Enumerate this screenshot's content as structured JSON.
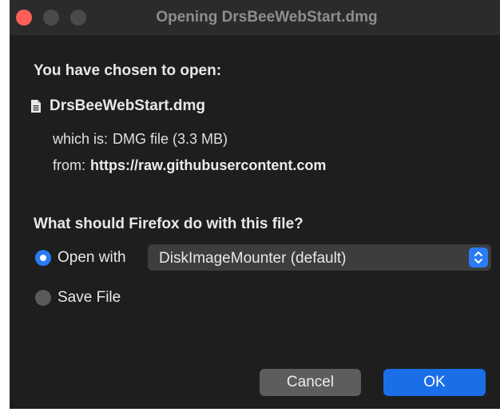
{
  "window": {
    "title": "Opening DrsBeeWebStart.dmg"
  },
  "dialog": {
    "heading": "You have chosen to open:",
    "file_name": "DrsBeeWebStart.dmg",
    "which_label": "which is:",
    "which_value": "DMG file (3.3 MB)",
    "from_label": "from:",
    "from_value": "https://raw.githubusercontent.com",
    "question": "What should Firefox do with this file?",
    "open_with_label": "Open with",
    "open_with_selected": "DiskImageMounter (default)",
    "save_file_label": "Save File",
    "open_with_checked": true,
    "save_file_checked": false
  },
  "buttons": {
    "cancel": "Cancel",
    "ok": "OK"
  },
  "colors": {
    "accent": "#2a7bf6",
    "close": "#ff5f57",
    "background": "#1e1e1e"
  }
}
